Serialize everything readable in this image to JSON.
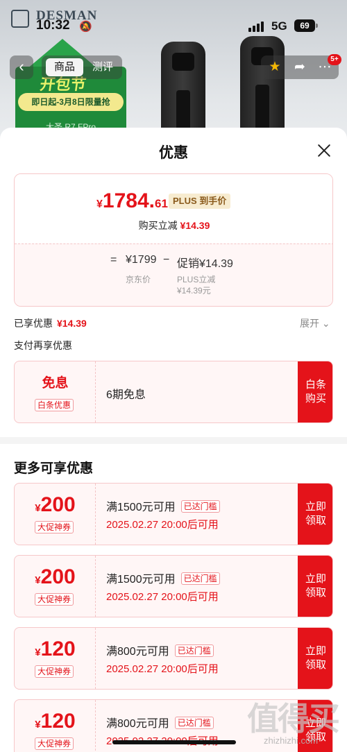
{
  "status_bar": {
    "time": "10:32",
    "network": "5G",
    "battery": "69"
  },
  "background": {
    "brand": "DESMAN",
    "banner_big": "开包节",
    "banner_ribbon": "即日起-3月8日限量抢",
    "banner_model": "大圣 R7 FPro"
  },
  "nav": {
    "tab_product": "商品",
    "tab_review": "测评",
    "message_badge": "5+"
  },
  "sheet": {
    "title": "优惠",
    "price_card": {
      "currency": "¥",
      "final_int": "1784.",
      "final_dec": "61",
      "plus_tag": "PLUS 到手价",
      "instant_label": "购买立减",
      "instant_value": "¥14.39",
      "eq": "=",
      "jd_price": "¥1799",
      "minus": "−",
      "promo": "促销¥14.39",
      "jd_price_label": "京东价",
      "plus_label": "PLUS立减",
      "plus_value": "¥14.39元"
    },
    "enjoyed_label": "已享优惠",
    "enjoyed_value": "¥14.39",
    "expand_label": "展开",
    "pay_more_label": "支付再享优惠",
    "baitiao_coupon": {
      "title": "免息",
      "tag": "白条优惠",
      "desc": "6期免息",
      "button": "白条购买"
    },
    "more_title": "更多可享优惠",
    "coupons": [
      {
        "currency": "¥",
        "amount": "200",
        "tag": "大促神券",
        "condition": "满1500元可用",
        "reached": "已达门槛",
        "time": "2025.02.27 20:00后可用",
        "button": "立即领取"
      },
      {
        "currency": "¥",
        "amount": "200",
        "tag": "大促神券",
        "condition": "满1500元可用",
        "reached": "已达门槛",
        "time": "2025.02.27 20:00后可用",
        "button": "立即领取"
      },
      {
        "currency": "¥",
        "amount": "120",
        "tag": "大促神券",
        "condition": "满800元可用",
        "reached": "已达门槛",
        "time": "2025.02.27 20:00后可用",
        "button": "立即领取"
      },
      {
        "currency": "¥",
        "amount": "120",
        "tag": "大促神券",
        "condition": "满800元可用",
        "reached": "已达门槛",
        "time": "2025.02.27 20:00后可用",
        "button": "立即领取"
      }
    ]
  },
  "watermark": {
    "text": "值得买",
    "sub": "zhizhizhi.com"
  },
  "colors": {
    "accent_red": "#e4131a",
    "plus_gold": "#8a5a1b",
    "pale_red": "#fff6f6"
  }
}
